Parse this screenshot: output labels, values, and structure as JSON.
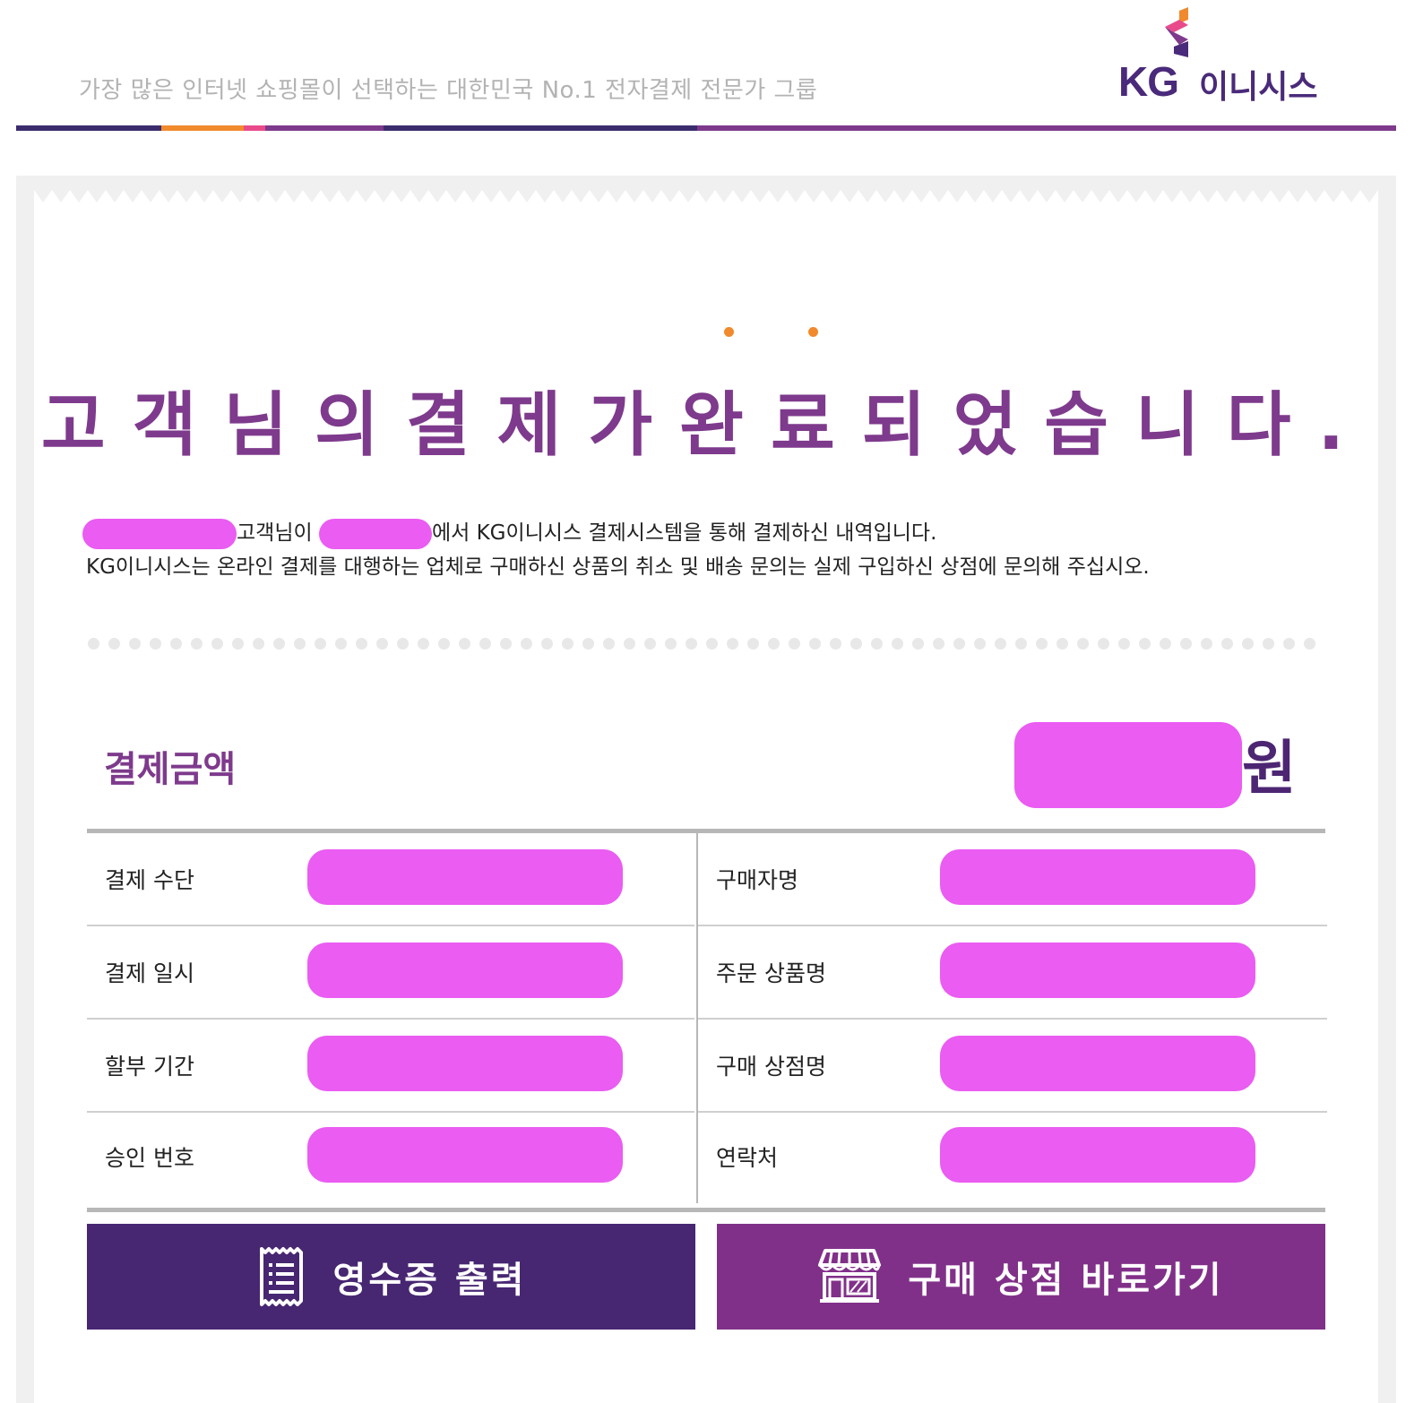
{
  "header": {
    "tagline": "가장 많은 인터넷 쇼핑몰이 선택하는 대한민국 No.1 전자결제 전문가 그룹",
    "logo": {
      "brand": "KG",
      "name": "이니시스"
    },
    "stripe_colors": [
      "#3b2c6e",
      "#f08a2c",
      "#e94b8a",
      "#7e3a8c",
      "#5a3a8c"
    ]
  },
  "title": "고객님의결제가완료되었습니다.",
  "description": {
    "line1_customer_suffix": "고객님이",
    "line1_rest": "에서 KG이니시스 결제시스템을 통해 결제하신 내역입니다.",
    "line2": "KG이니시스는 온라인 결제를 대행하는 업체로 구매하신 상품의 취소 및 배송 문의는 실제 구입하신 상점에 문의해 주십시오."
  },
  "amount": {
    "label": "결제금액",
    "unit": "원"
  },
  "table": {
    "left": [
      {
        "label": "결제 수단"
      },
      {
        "label": "결제 일시"
      },
      {
        "label": "할부 기간"
      },
      {
        "label": "승인 번호"
      }
    ],
    "right": [
      {
        "label": "구매자명"
      },
      {
        "label": "주문 상품명"
      },
      {
        "label": "구매 상점명"
      },
      {
        "label": "연락처"
      }
    ]
  },
  "buttons": {
    "receipt": {
      "label": "영수증 출력",
      "icon": "receipt-icon"
    },
    "store": {
      "label": "구매 상점 바로가기",
      "icon": "store-icon"
    }
  },
  "colors": {
    "brand_purple": "#7e3a8c",
    "dark_purple": "#472672",
    "accent_orange": "#f08a2c",
    "redaction_pink": "#ea5cf2"
  }
}
